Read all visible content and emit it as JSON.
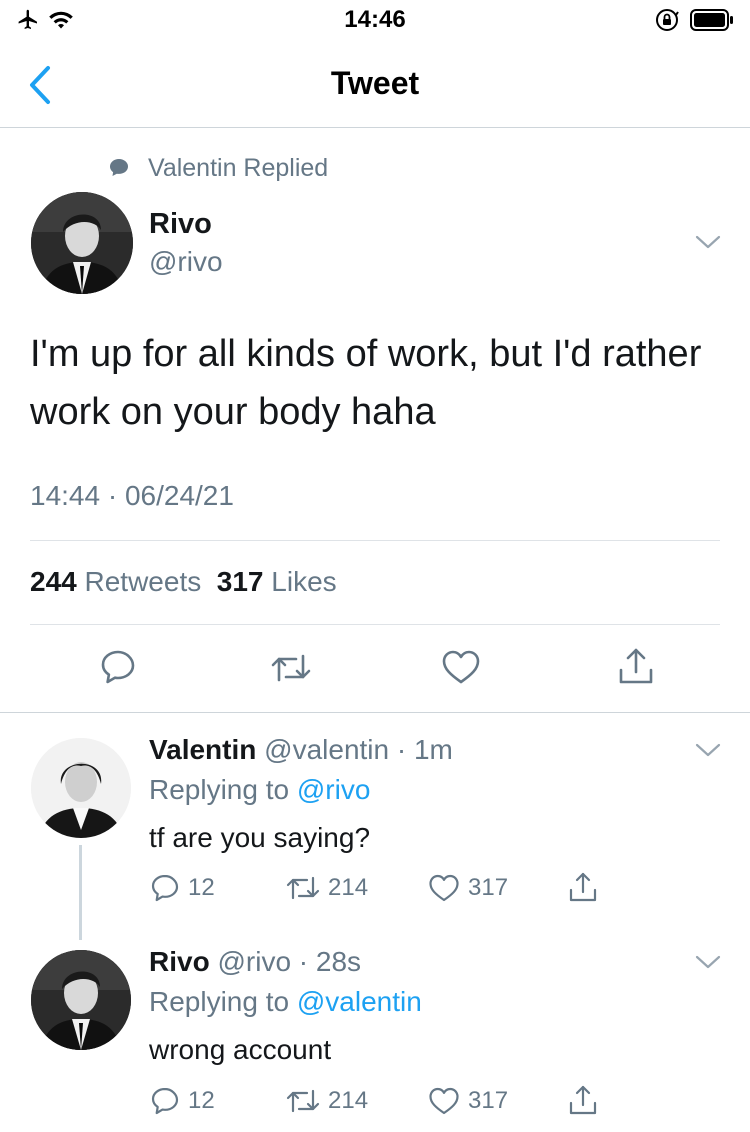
{
  "status_bar": {
    "time": "14:46"
  },
  "nav": {
    "title": "Tweet"
  },
  "main_tweet": {
    "social_context": "Valentin Replied",
    "display_name": "Rivo",
    "handle": "@rivo",
    "text": "I'm up for all kinds of work, but I'd rather work on your body haha",
    "timestamp": "14:44 · 06/24/21",
    "retweet_count": "244",
    "retweet_label": "Retweets",
    "like_count": "317",
    "like_label": "Likes"
  },
  "replies": [
    {
      "display_name": "Valentin",
      "handle": "@valentin",
      "time": "· 1m",
      "replying_prefix": "Replying to",
      "replying_to": "@rivo",
      "text": "tf are you saying?",
      "reply_count": "12",
      "retweet_count": "214",
      "like_count": "317"
    },
    {
      "display_name": "Rivo",
      "handle": "@rivo",
      "time": "· 28s",
      "replying_prefix": "Replying to",
      "replying_to": "@valentin",
      "text": "wrong account",
      "reply_count": "12",
      "retweet_count": "214",
      "like_count": "317"
    }
  ],
  "colors": {
    "accent": "#1da1f2",
    "muted": "#657786",
    "text": "#14171a",
    "divider": "#ced5da"
  },
  "icons": {
    "status_left": [
      "airplane-icon",
      "wifi-icon"
    ],
    "status_right": [
      "orientation-lock-icon",
      "battery-icon"
    ],
    "main_actions": [
      "reply-icon",
      "retweet-icon",
      "like-icon",
      "share-icon"
    ]
  }
}
